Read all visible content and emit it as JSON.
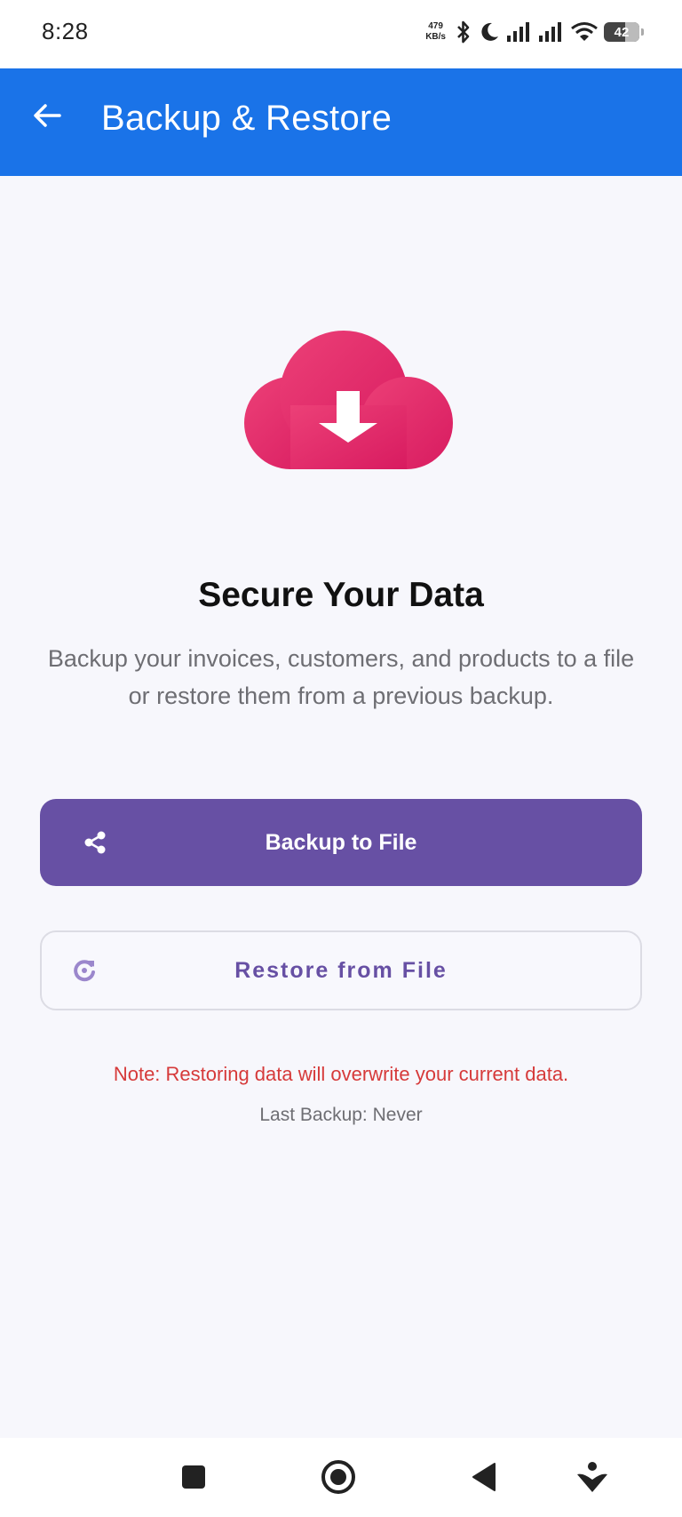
{
  "status_bar": {
    "time": "8:28",
    "net_speed_value": "479",
    "net_speed_unit": "KB/s",
    "battery_level": "42",
    "icons": [
      "bluetooth-icon",
      "moon-icon",
      "signal-icon",
      "signal-icon",
      "wifi-icon",
      "battery-icon"
    ]
  },
  "app_bar": {
    "title": "Backup & Restore",
    "back_icon": "arrow-left-icon",
    "background_color": "#1a73e8"
  },
  "hero": {
    "icon": "cloud-download-icon",
    "icon_color": "#e0306a",
    "headline": "Secure Your Data",
    "description": "Backup your invoices, customers, and products to a file or restore them from a previous backup."
  },
  "actions": {
    "backup_label": "Backup to File",
    "backup_icon": "share-icon",
    "backup_color": "#6750a4",
    "restore_label": "Restore from File",
    "restore_icon": "restore-icon"
  },
  "footer": {
    "note": "Note: Restoring data will overwrite your current data.",
    "note_color": "#d63a3a",
    "last_backup": "Last Backup: Never"
  },
  "nav_bar": {
    "icons": [
      "recents-square-icon",
      "home-circle-icon",
      "back-triangle-icon",
      "assistant-icon"
    ]
  }
}
